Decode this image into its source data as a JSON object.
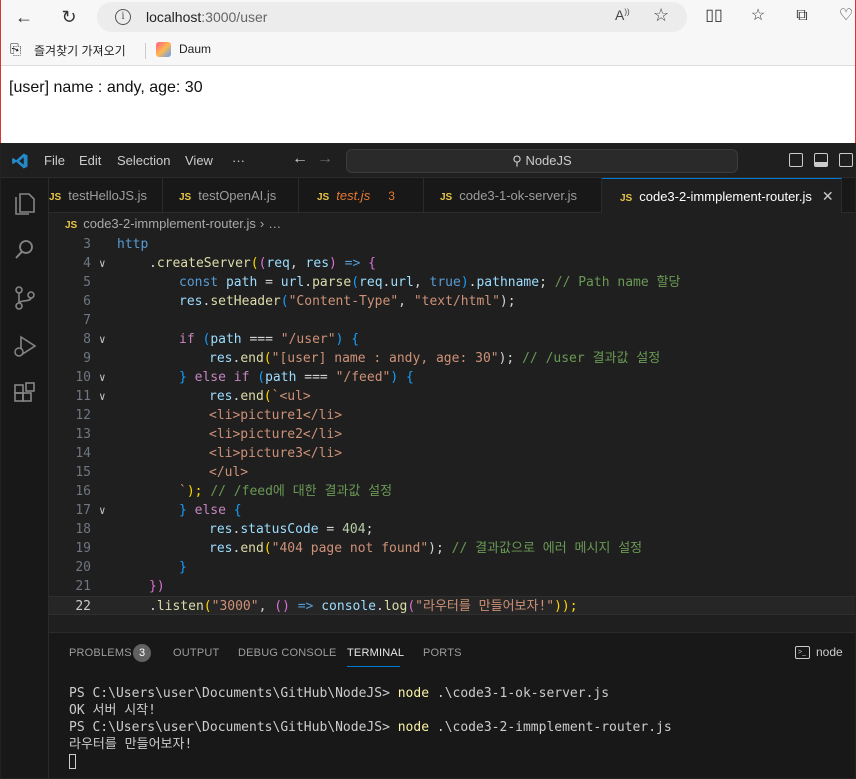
{
  "browser": {
    "url_host": "localhost",
    "url_path": ":3000/user",
    "read_aloud": "A",
    "bookmarks": [
      {
        "label": "즐겨찾기 가져오기"
      },
      {
        "label": "Daum"
      }
    ],
    "page_text": "[user] name : andy, age: 30"
  },
  "vscode": {
    "menu": [
      "File",
      "Edit",
      "Selection",
      "View",
      "···"
    ],
    "command_center": "NodeJS",
    "tabs": [
      {
        "label": "testHelloJS.js",
        "icon": "JS"
      },
      {
        "label": "testOpenAI.js",
        "icon": "JS"
      },
      {
        "label": "test.js",
        "icon": "JS",
        "problems": "3"
      },
      {
        "label": "code3-1-ok-server.js",
        "icon": "JS"
      },
      {
        "label": "code3-2-immplement-router.js",
        "icon": "JS",
        "active": true
      }
    ],
    "breadcrumb": {
      "file": "code3-2-immplement-router.js",
      "tail": "…"
    },
    "line_numbers": [
      "3",
      "4",
      "5",
      "6",
      "7",
      "8",
      "9",
      "10",
      "11",
      "12",
      "13",
      "14",
      "15",
      "16",
      "17",
      "18",
      "19",
      "20",
      "21",
      "22"
    ],
    "code": {
      "l3": "http",
      "l4a": ".",
      "l4b": "createServer",
      "l4c": "(",
      "l4d": "(",
      "l4e": "req",
      "l4f": ", ",
      "l4g": "res",
      "l4h": ")",
      "l4i": " => ",
      "l4j": "{",
      "l5": [
        "const",
        " path",
        " = ",
        "url",
        ".",
        "parse",
        "(",
        "req",
        ".",
        "url",
        ", ",
        "true",
        ")",
        ".",
        "pathname",
        "; ",
        "// Path name 할당"
      ],
      "l6": [
        "res",
        ".",
        "setHeader",
        "(",
        "\"Content-Type\"",
        ", ",
        "\"text/html\"",
        ");"
      ],
      "l8": [
        "if",
        " (",
        "path",
        " === ",
        "\"/user\"",
        ") ",
        "{"
      ],
      "l9": [
        "res",
        ".",
        "end",
        "(",
        "\"[user] name : andy, age: 30\"",
        "); ",
        "// /user 결과값 설정"
      ],
      "l10": [
        "}",
        " else ",
        "if",
        " (",
        "path",
        " === ",
        "\"/feed\"",
        ") ",
        "{"
      ],
      "l11": [
        "res",
        ".",
        "end",
        "(",
        "`<ul>"
      ],
      "l12": "<li>picture1</li>",
      "l13": "<li>picture2</li>",
      "l14": "<li>picture3</li>",
      "l15": "</ul>",
      "l16": [
        "`",
        "); ",
        "// /feed에 대한 결과값 설정"
      ],
      "l17": [
        "}",
        " else ",
        "{"
      ],
      "l18": [
        "res",
        ".",
        "statusCode",
        " = ",
        "404",
        ";"
      ],
      "l19": [
        "res",
        ".",
        "end",
        "(",
        "\"404 page not found\"",
        "); ",
        "// 결과값으로 에러 메시지 설정"
      ],
      "l20": "}",
      "l21": "})",
      "l22": [
        ".",
        "listen",
        "(",
        "\"3000\"",
        ", ",
        "()",
        " => ",
        "console",
        ".",
        "log",
        "(",
        "\"라우터를 만들어보자!\"",
        "));"
      ]
    },
    "panel": {
      "tabs": [
        "PROBLEMS",
        "OUTPUT",
        "DEBUG CONSOLE",
        "TERMINAL",
        "PORTS"
      ],
      "problems_count": "3",
      "terminal_name": "node",
      "terminal_lines": [
        {
          "prompt": "PS C:\\Users\\user\\Documents\\GitHub\\NodeJS> ",
          "cmd": "node",
          "args": " .\\code3-1-ok-server.js"
        },
        {
          "text": "OK 서버 시작!"
        },
        {
          "prompt": "PS C:\\Users\\user\\Documents\\GitHub\\NodeJS> ",
          "cmd": "node",
          "args": " .\\code3-2-immplement-router.js"
        },
        {
          "text": "라우터를 만들어보자!"
        }
      ]
    }
  }
}
